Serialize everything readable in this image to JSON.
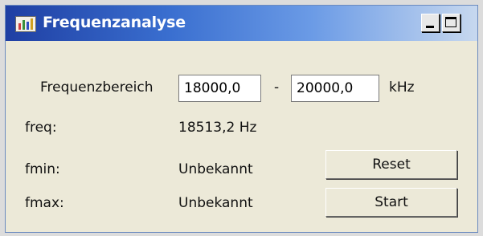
{
  "window": {
    "title": "Frequenzanalyse",
    "colors": {
      "titlebar_start": "#1f3fa3",
      "titlebar_end": "#c7d8ef",
      "face": "#ece9d8"
    },
    "controls": {
      "minimize_icon": "minimize-icon",
      "maximize_icon": "maximize-icon"
    }
  },
  "range": {
    "label": "Frequenzbereich",
    "from_value": "18000,0",
    "separator": "-",
    "to_value": "20000,0",
    "unit": "kHz"
  },
  "readouts": {
    "freq_label": "freq:",
    "freq_value": "18513,2 Hz",
    "fmin_label": "fmin:",
    "fmin_value": "Unbekannt",
    "fmax_label": "fmax:",
    "fmax_value": "Unbekannt"
  },
  "buttons": {
    "reset_label": "Reset",
    "start_label": "Start"
  }
}
